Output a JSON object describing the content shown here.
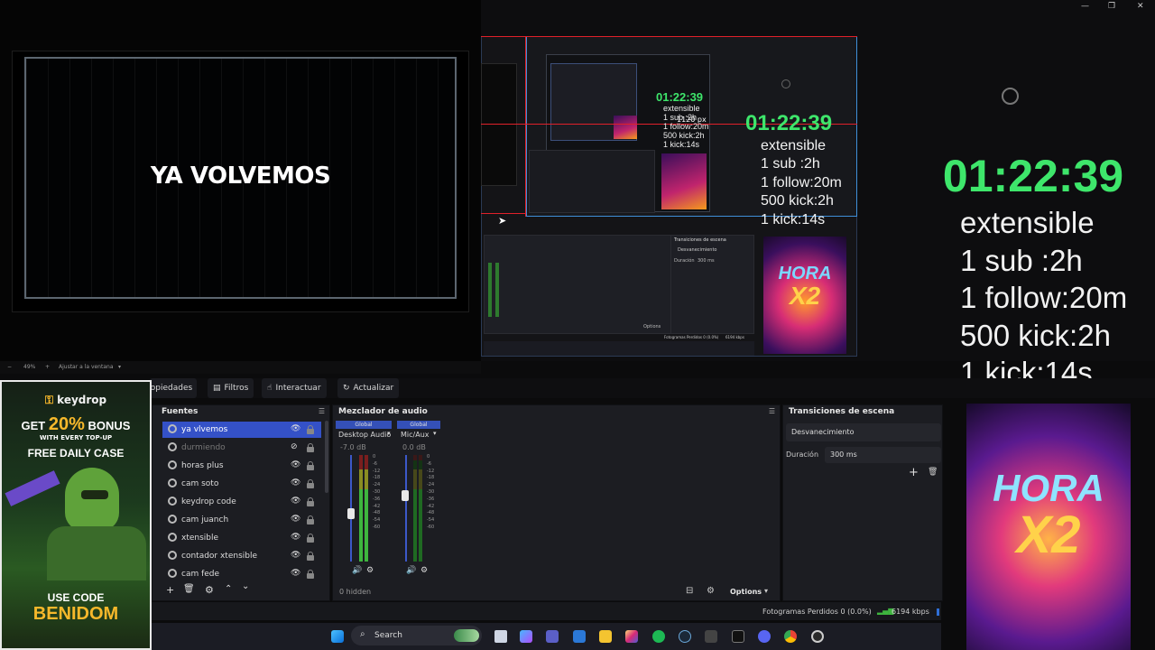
{
  "preview": {
    "banner": "YA VOLVEMOS",
    "zoom": "49%",
    "fit_label": "Ajustar a la ventana"
  },
  "overlay": {
    "timer": "01:22:39",
    "lines": [
      "extensible",
      "1 sub :2h",
      "1 follow:20m",
      "500 kick:2h",
      "1 kick:14s"
    ],
    "cursor_size_label": "1120 px"
  },
  "hora_badge": {
    "line1": "HORA",
    "line2": "X2"
  },
  "toolbar": {
    "properties": "Propiedades",
    "filters": "Filtros",
    "interact": "Interactuar",
    "refresh": "Actualizar"
  },
  "sources": {
    "title": "Fuentes",
    "items": [
      {
        "label": "ya vlvemos",
        "state": "selected"
      },
      {
        "label": "durmiendo",
        "state": "hidden"
      },
      {
        "label": "horas plus",
        "state": "visible"
      },
      {
        "label": "cam soto",
        "state": "visible"
      },
      {
        "label": "keydrop code",
        "state": "visible"
      },
      {
        "label": "cam juanch",
        "state": "visible"
      },
      {
        "label": "xtensible",
        "state": "visible"
      },
      {
        "label": "contador xtensible",
        "state": "visible"
      },
      {
        "label": "cam fede",
        "state": "visible"
      }
    ]
  },
  "mixer": {
    "title": "Mezclador de audio",
    "channels": [
      {
        "badge": "Global",
        "name": "Desktop Audio",
        "db": "-7.0 dB",
        "level": 0.45
      },
      {
        "badge": "Global",
        "name": "Mic/Aux",
        "db": "0.0 dB",
        "level": 0.62
      }
    ],
    "scale": [
      "0",
      "-6",
      "-12",
      "-18",
      "-24",
      "-30",
      "-36",
      "-42",
      "-48",
      "-54",
      "-60"
    ],
    "hidden": "0 hidden",
    "options": "Options"
  },
  "transitions": {
    "title": "Transiciones de escena",
    "selected": "Desvanecimiento",
    "duration_label": "Duración",
    "duration_value": "300 ms"
  },
  "status": {
    "dropped": "Fotogramas Perdidos 0 (0.0%)",
    "bitrate": "6194 kbps"
  },
  "taskbar": {
    "search": "Search"
  },
  "ad": {
    "brand": "keydrop",
    "get": "GET",
    "percent": "20%",
    "bonus": "BONUS",
    "with": "WITH EVERY TOP-UP",
    "free": "FREE DAILY CASE",
    "use_code": "USE CODE",
    "code": "BENIDOM"
  },
  "colors": {
    "accent": "#3451c7",
    "timer_green": "#3ee66b",
    "guide_red": "#e0202a"
  }
}
